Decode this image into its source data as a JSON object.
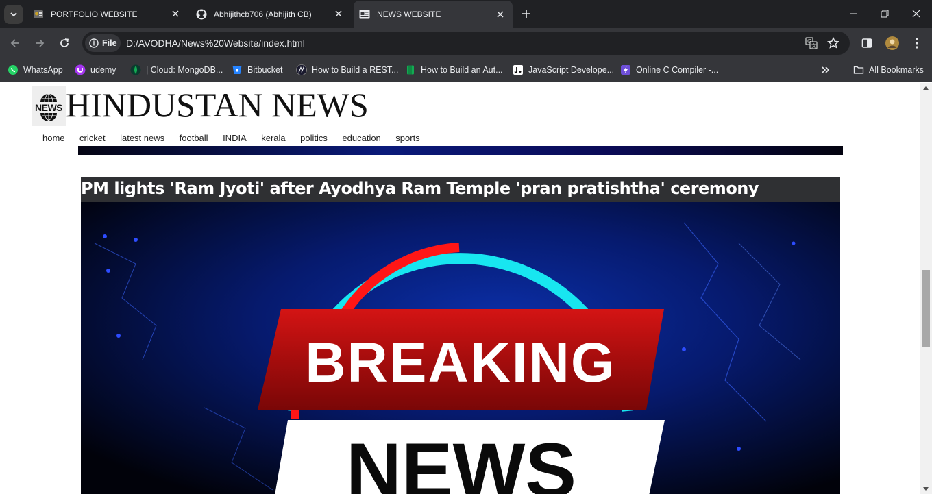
{
  "browser": {
    "tabs": [
      {
        "title": "PORTFOLIO WEBSITE",
        "active": false
      },
      {
        "title": "Abhijithcb706 (Abhijith CB)",
        "active": false
      },
      {
        "title": "NEWS WEBSITE",
        "active": true
      }
    ],
    "address": {
      "scheme_label": "File",
      "url": "D:/AVODHA/News%20Website/index.html"
    },
    "bookmarks": [
      {
        "label": "WhatsApp",
        "icon": "whatsapp-icon"
      },
      {
        "label": "udemy",
        "icon": "udemy-icon"
      },
      {
        "label": "| Cloud: MongoDB...",
        "icon": "mongodb-icon"
      },
      {
        "label": "Bitbucket",
        "icon": "bitbucket-icon"
      },
      {
        "label": "How to Build a REST...",
        "icon": "article-icon"
      },
      {
        "label": "How to Build an Aut...",
        "icon": "book-icon"
      },
      {
        "label": "JavaScript Develope...",
        "icon": "js-icon"
      },
      {
        "label": "Online C Compiler -...",
        "icon": "compiler-icon"
      }
    ],
    "all_bookmarks_label": "All Bookmarks"
  },
  "site": {
    "logo_text": "NEWS",
    "title": "HINDUSTAN NEWS",
    "nav": [
      "home",
      "cricket",
      "latest news",
      "football",
      "INDIA",
      "kerala",
      "politics",
      "education",
      "sports"
    ],
    "article": {
      "headline": "PM lights 'Ram Jyoti' after Ayodhya Ram Temple 'pran pratishtha' ceremony",
      "image_text_top": "BREAKING",
      "image_text_bottom": "NEWS"
    }
  },
  "colors": {
    "tab_bar": "#202124",
    "toolbar": "#35363a",
    "headline_bar": "#2f3033",
    "breaking_red": "#b30f0f",
    "ring_cyan": "#18e6f0"
  }
}
